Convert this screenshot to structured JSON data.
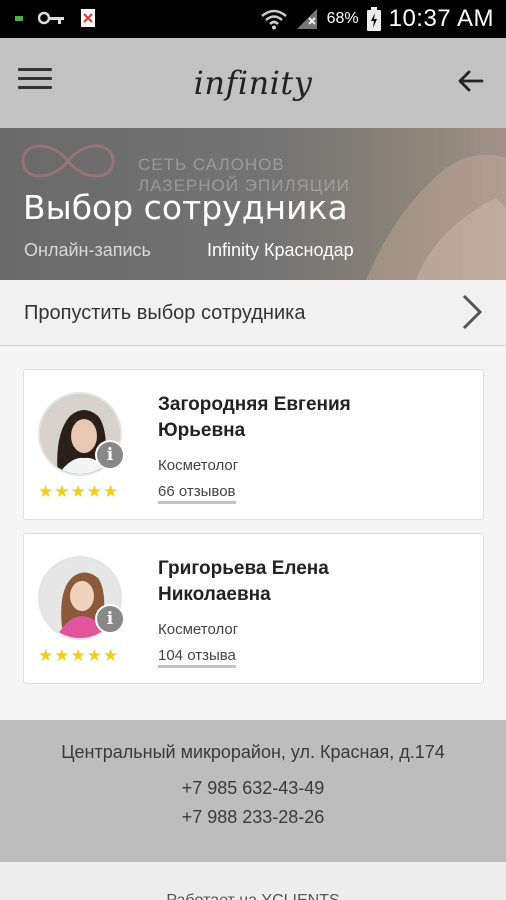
{
  "status_bar": {
    "battery": "68%",
    "time": "10:37 AM"
  },
  "app_bar": {
    "logo": "infinity"
  },
  "hero": {
    "brand_line1": "СЕТЬ САЛОНОВ",
    "brand_line2": "ЛАЗЕРНОЙ ЭПИЛЯЦИИ",
    "title": "Выбор сотрудника",
    "subtitle_left": "Онлайн-запись",
    "subtitle_right": "Infinity Краснодар"
  },
  "skip": {
    "label": "Пропустить выбор сотрудника"
  },
  "employees": [
    {
      "name_line1": "Загородняя Евгения",
      "name_line2": "Юрьевна",
      "role": "Косметолог",
      "reviews": "66 отзывов",
      "rating": 5
    },
    {
      "name_line1": "Григорьева Елена",
      "name_line2": "Николаевна",
      "role": "Косметолог",
      "reviews": "104 отзыва",
      "rating": 5
    }
  ],
  "footer": {
    "address": "Центральный микрорайон, ул. Красная, д.174",
    "phone1": "+7 985 632-43-49",
    "phone2": "+7 988 233-28-26",
    "bottom_text": "Работает на YCLIENTS"
  }
}
